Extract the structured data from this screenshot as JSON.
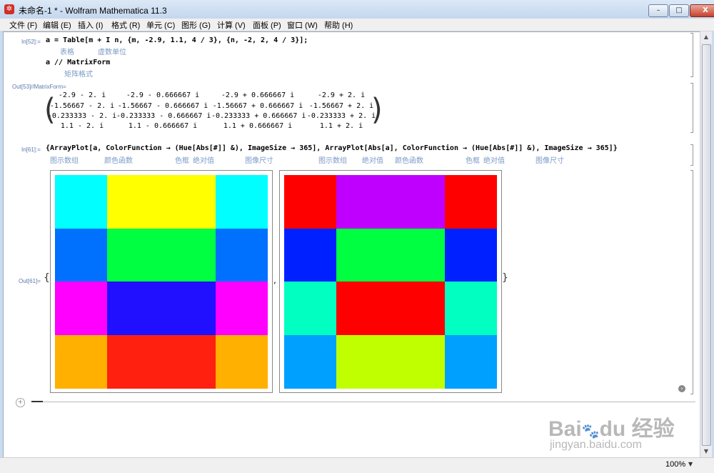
{
  "window": {
    "title": "未命名-1 * - Wolfram Mathematica 11.3",
    "minimize": "–",
    "maximize": "□",
    "close": "X"
  },
  "menu": [
    "文件 (F)",
    "编辑 (E)",
    "插入 (I)",
    "格式 (R)",
    "单元 (C)",
    "图形 (G)",
    "计算 (V)",
    "面板 (P)",
    "窗口 (W)",
    "帮助 (H)"
  ],
  "cells": {
    "in52_label": "In[52]:=",
    "in52_code": "a = Table[m + I n, {m, -2.9, 1.1, 4 / 3}, {n, -2, 2, 4 / 3}];",
    "in52_hint1": "表格",
    "in52_hint2": "虚数单位",
    "in52_code2": "a // MatrixForm",
    "in52_hint3": "矩阵格式",
    "out53_label": "Out[53]//MatrixForm=",
    "matrix": [
      [
        "-2.9 - 2. i",
        "-2.9 - 0.666667 i",
        "-2.9 + 0.666667 i",
        "-2.9 + 2. i"
      ],
      [
        "-1.56667 - 2. i",
        "-1.56667 - 0.666667 i",
        "-1.56667 + 0.666667 i",
        "-1.56667 + 2. i"
      ],
      [
        "-0.233333 - 2. i",
        "-0.233333 - 0.666667 i",
        "-0.233333 + 0.666667 i",
        "-0.233333 + 2. i"
      ],
      [
        "1.1 - 2. i",
        "1.1 - 0.666667 i",
        "1.1 + 0.666667 i",
        "1.1 + 2. i"
      ]
    ],
    "in61_label": "In[61]:=",
    "in61_code": "{ArrayPlot[a, ColorFunction → (Hue[Abs[#]] &), ImageSize → 365], ArrayPlot[Abs[a], ColorFunction → (Hue[Abs[#]] &), ImageSize → 365]}",
    "in61_hints": [
      "图示数组",
      "颜色函数",
      "色框",
      "绝对值",
      "图像尺寸",
      "图示数组",
      "绝对值",
      "颜色函数",
      "色框",
      "绝对值",
      "图像尺寸"
    ],
    "out61_label": "Out[61]=",
    "comma": ","
  },
  "plots": {
    "left_colors": [
      [
        "#00ffff",
        "#ffff00",
        "#ffff00",
        "#00ffff"
      ],
      [
        "#0070ff",
        "#00ff40",
        "#00ff40",
        "#0070ff"
      ],
      [
        "#ff00ff",
        "#2010ff",
        "#2010ff",
        "#ff00ff"
      ],
      [
        "#ffb000",
        "#ff2010",
        "#ff2010",
        "#ffb000"
      ]
    ],
    "right_colors": [
      [
        "#ff0000",
        "#c000ff",
        "#c000ff",
        "#ff0000"
      ],
      [
        "#0020ff",
        "#00ff40",
        "#00ff40",
        "#0020ff"
      ],
      [
        "#00ffc0",
        "#ff0000",
        "#ff0000",
        "#00ffc0"
      ],
      [
        "#00a0ff",
        "#c0ff00",
        "#c0ff00",
        "#00a0ff"
      ]
    ]
  },
  "status": {
    "zoom": "100%"
  },
  "watermark": {
    "logo": "Bai du 经验",
    "url": "jingyan.baidu.com"
  }
}
